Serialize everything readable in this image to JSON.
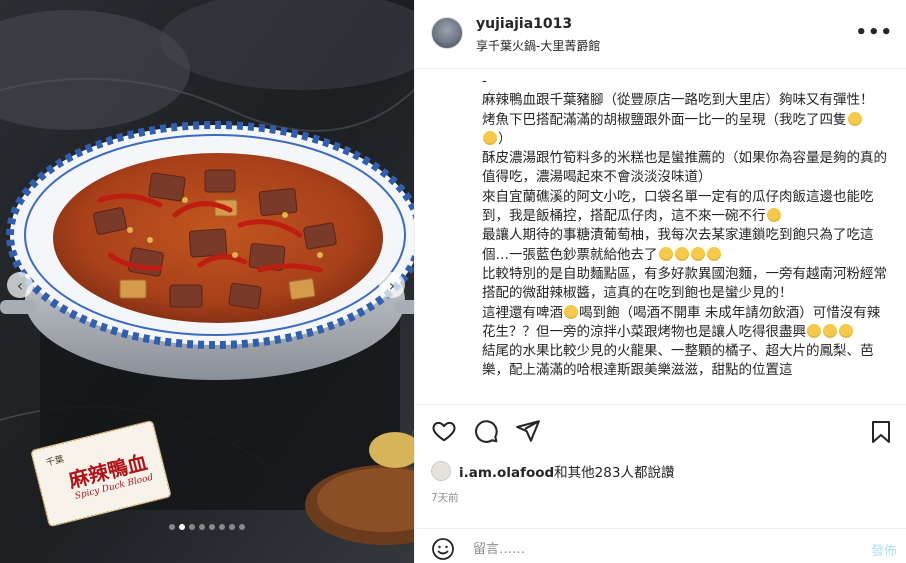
{
  "header": {
    "username": "yujiajia1013",
    "location": "享千葉火鍋-大里菁爵館",
    "more_label": "•••"
  },
  "photo": {
    "sign_title": "麻辣鴨血",
    "sign_subtitle": "Spicy Duck Blood",
    "sign_brand": "千葉",
    "nav_prev": "‹",
    "nav_next": "›",
    "slide_count": 8,
    "active_slide": 1
  },
  "caption": {
    "lines": [
      "-",
      "麻辣鴨血跟千葉豬腳（從豐原店一路吃到大里店）夠味又有彈性！",
      "烤魚下巴搭配滿滿的胡椒鹽跟外面一比一的呈現（我吃了四隻",
      "）",
      "酥皮濃湯跟竹筍料多的米糕也是蠻推薦的（如果你為容量是夠的真的值得吃，濃湯喝起來不會淡淡沒味道）",
      "來自宜蘭礁溪的阿文小吃，口袋名單一定有的瓜仔肉飯這邊也能吃到，我是飯桶控，搭配瓜仔肉，這不來一碗不行",
      "最讓人期待的事糖漬葡萄柚，我每次去某家連鎖吃到飽只為了吃這個…一張藍色鈔票就給他去了",
      "比較特別的是自助麵點區，有多好款異國泡麵，一旁有越南河粉經常搭配的微甜辣椒醬，這真的在吃到飽也是蠻少見的！",
      "這裡還有啤酒",
      "喝到飽（喝酒不開車 未成年請勿飲酒）可惜沒有辣花生？？但一旁的涼拌小菜跟烤物也是讓人吃得很盡興",
      "結尾的水果比較少見的火龍果、一整顆的橘子、超大片的鳳梨、芭樂，配上滿滿的哈根達斯跟美樂滋滋，甜點的位置這"
    ]
  },
  "actions": {
    "like": "like-icon",
    "comment": "comment-icon",
    "share": "share-icon",
    "save": "save-icon"
  },
  "likes": {
    "user": "i.am.olafood",
    "text": "和其他283人都說讚"
  },
  "time_ago": "7天前",
  "comment": {
    "placeholder": "留言……",
    "post_label": "發佈"
  },
  "colors": {
    "post_button": "#b2dffc",
    "muted_text": "#8e8e8e",
    "emoji": "#f7c948"
  }
}
